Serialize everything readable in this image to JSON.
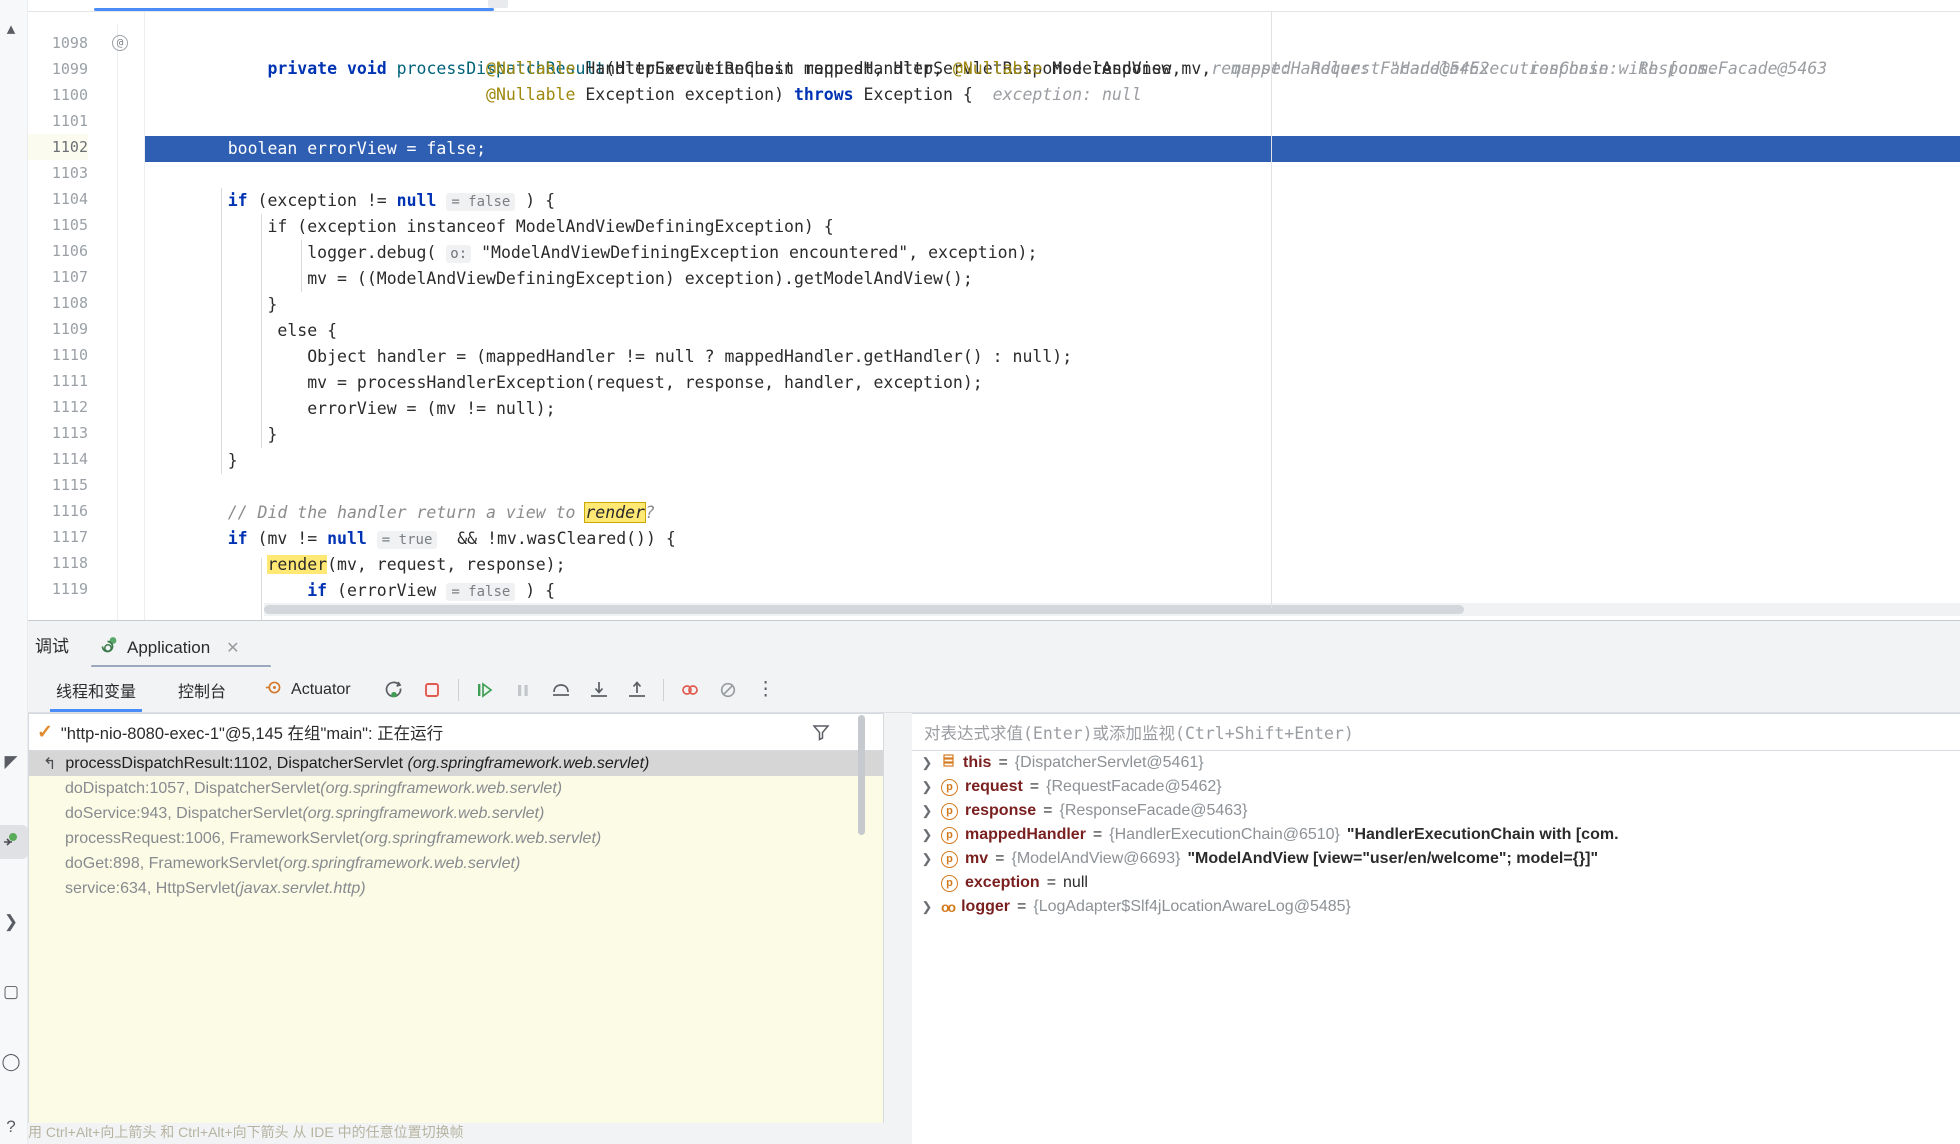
{
  "editor": {
    "first_line": 1098,
    "current_line": 1102,
    "lines": [
      {
        "n": 1098,
        "at": true
      },
      {
        "n": 1099
      },
      {
        "n": 1100
      },
      {
        "n": 1101
      },
      {
        "n": 1102,
        "current": true
      },
      {
        "n": 1103
      },
      {
        "n": 1104
      },
      {
        "n": 1105
      },
      {
        "n": 1106
      },
      {
        "n": 1107
      },
      {
        "n": 1108
      },
      {
        "n": 1109
      },
      {
        "n": 1110
      },
      {
        "n": 1111
      },
      {
        "n": 1112
      },
      {
        "n": 1113
      },
      {
        "n": 1114
      },
      {
        "n": 1115
      },
      {
        "n": 1116
      },
      {
        "n": 1117
      },
      {
        "n": 1118
      },
      {
        "n": 1119
      }
    ],
    "code": {
      "l1098": "private void processDispatchResult(HttpServletRequest request, HttpServletResponse response,",
      "l1098_hint1": "request:  RequestFacade@5462",
      "l1098_hint2": "response:  ResponseFacade@5463",
      "l1099": "@Nullable HandlerExecutionChain mappedHandler, @Nullable ModelAndView mv,",
      "l1099_hint": "mappedHandler:  \"HandlerExecutionChain with [com.",
      "l1100": "@Nullable Exception exception) throws Exception {",
      "l1100_hint": "exception: null",
      "l1102": "boolean errorView = false;",
      "l1104": "if (exception != null",
      "l1104_hint": "= false",
      "l1104_tail": ") {",
      "l1105": "if (exception instanceof ModelAndViewDefiningException) {",
      "l1106_a": "logger.debug(",
      "l1106_hint": "o:",
      "l1106_b": "\"ModelAndViewDefiningException encountered\", exception);",
      "l1107": "mv = ((ModelAndViewDefiningException) exception).getModelAndView();",
      "l1108": "}",
      "l1109": "else {",
      "l1110": "Object handler = (mappedHandler != null ? mappedHandler.getHandler() : null);",
      "l1111": "mv = processHandlerException(request, response, handler, exception);",
      "l1112": "errorView = (mv != null);",
      "l1113": "}",
      "l1114": "}",
      "l1116_a": "// Did the handler return a view to ",
      "l1116_hl": "render",
      "l1116_b": "?",
      "l1117_a": "if (mv != null",
      "l1117_hint": "= true",
      "l1117_b": " && !mv.wasCleared()) {",
      "l1118_hl": "render",
      "l1118_b": "(mv, request, response);",
      "l1119_a": "if (errorView",
      "l1119_hint": "= false",
      "l1119_b": ") {"
    }
  },
  "debug": {
    "panel_title": "调试",
    "tab_label": "Application",
    "tab_close": "✕",
    "toolbar": {
      "threads_tab": "线程和变量",
      "console_tab": "控制台",
      "actuator_tab": "Actuator",
      "icons": [
        {
          "name": "rerun-icon",
          "glyph": "rerun"
        },
        {
          "name": "stop-icon",
          "glyph": "stop"
        },
        {
          "name": "resume-program-icon",
          "glyph": "resume"
        },
        {
          "name": "pause-program-icon",
          "glyph": "pause"
        },
        {
          "name": "step-over-icon",
          "glyph": "step-over"
        },
        {
          "name": "step-into-icon",
          "glyph": "step-into"
        },
        {
          "name": "step-out-icon",
          "glyph": "step-out"
        },
        {
          "name": "mute-breakpoints-icon",
          "glyph": "mute"
        },
        {
          "name": "view-breakpoints-icon",
          "glyph": "bp-off"
        },
        {
          "name": "more-options-icon",
          "glyph": "⋮"
        }
      ]
    },
    "thread": {
      "status_icon": "✓",
      "text": "\"http-nio-8080-exec-1\"@5,145 在组\"main\": 正在运行"
    },
    "frames": [
      {
        "text": "processDispatchResult:1102, DispatcherServlet ",
        "pkg": "(org.springframework.web.servlet)",
        "selected": true
      },
      {
        "text": "doDispatch:1057, DispatcherServlet ",
        "pkg": "(org.springframework.web.servlet)"
      },
      {
        "text": "doService:943, DispatcherServlet ",
        "pkg": "(org.springframework.web.servlet)"
      },
      {
        "text": "processRequest:1006, FrameworkServlet ",
        "pkg": "(org.springframework.web.servlet)"
      },
      {
        "text": "doGet:898, FrameworkServlet ",
        "pkg": "(org.springframework.web.servlet)"
      },
      {
        "text": "service:634, HttpServlet ",
        "pkg": "(javax.servlet.http)"
      }
    ],
    "frames_hint": "使用 Ctrl+Alt+向上箭头 和 Ctrl+Alt+向下箭头 从 IDE 中的任意位置切换帧",
    "watch_placeholder": "对表达式求值(Enter)或添加监视(Ctrl+Shift+Enter)",
    "variables": [
      {
        "expand": true,
        "icon": "field",
        "name": "this",
        "eq": "=",
        "value": "{DispatcherServlet@5461}"
      },
      {
        "expand": true,
        "icon": "param",
        "name": "request",
        "eq": "=",
        "value": "{RequestFacade@5462}"
      },
      {
        "expand": true,
        "icon": "param",
        "name": "response",
        "eq": "=",
        "value": "{ResponseFacade@5463}"
      },
      {
        "expand": true,
        "icon": "param",
        "name": "mappedHandler",
        "eq": "=",
        "value": "{HandlerExecutionChain@6510}",
        "str": "\"HandlerExecutionChain with [com."
      },
      {
        "expand": true,
        "icon": "param",
        "name": "mv",
        "eq": "=",
        "value": "{ModelAndView@6693}",
        "str": "\"ModelAndView [view=\"user/en/welcome\"; model={}]\""
      },
      {
        "expand": false,
        "icon": "param",
        "name": "exception",
        "eq": "=",
        "value": "null",
        "plain": true
      },
      {
        "expand": true,
        "icon": "static",
        "name": "logger",
        "eq": "=",
        "value": "{LogAdapter$Slf4jLocationAwareLog@5485}"
      }
    ]
  }
}
